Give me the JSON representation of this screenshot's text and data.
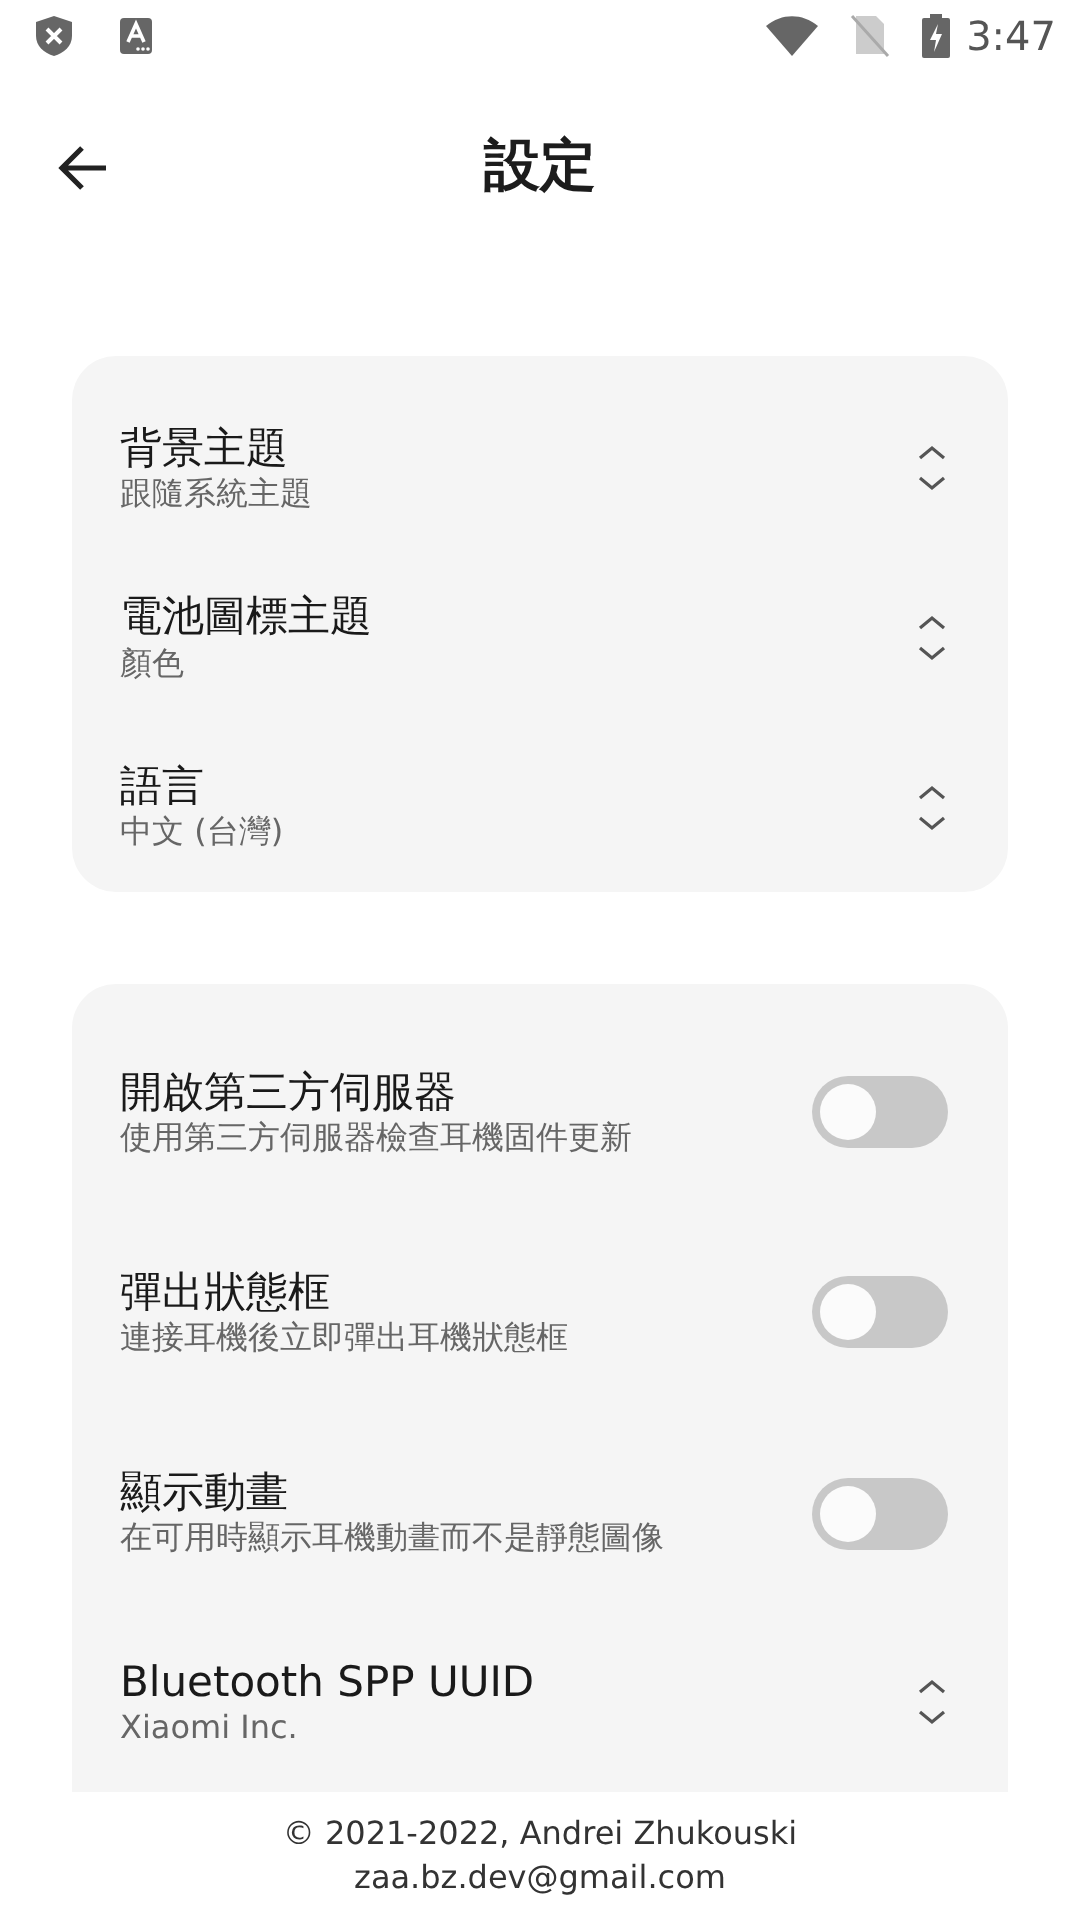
{
  "status_bar": {
    "time": "3:47"
  },
  "header": {
    "title": "設定"
  },
  "groups": [
    {
      "items": [
        {
          "kind": "select",
          "title": "背景主題",
          "subtitle": "跟隨系統主題"
        },
        {
          "kind": "select",
          "title": "電池圖標主題",
          "subtitle": "顏色"
        },
        {
          "kind": "select",
          "title": "語言",
          "subtitle": "中文 (台灣)"
        }
      ]
    },
    {
      "items": [
        {
          "kind": "toggle",
          "title": "開啟第三方伺服器",
          "subtitle": "使用第三方伺服器檢查耳機固件更新",
          "on": false
        },
        {
          "kind": "toggle",
          "title": "彈出狀態框",
          "subtitle": "連接耳機後立即彈出耳機狀態框",
          "on": false
        },
        {
          "kind": "toggle",
          "title": "顯示動畫",
          "subtitle": "在可用時顯示耳機動畫而不是靜態圖像",
          "on": false
        },
        {
          "kind": "select",
          "title": "Bluetooth SPP UUID",
          "subtitle": "Xiaomi Inc."
        }
      ]
    }
  ],
  "footer": {
    "copyright": "© 2021-2022, Andrei Zhukouski",
    "email": "zaa.bz.dev@gmail.com"
  }
}
